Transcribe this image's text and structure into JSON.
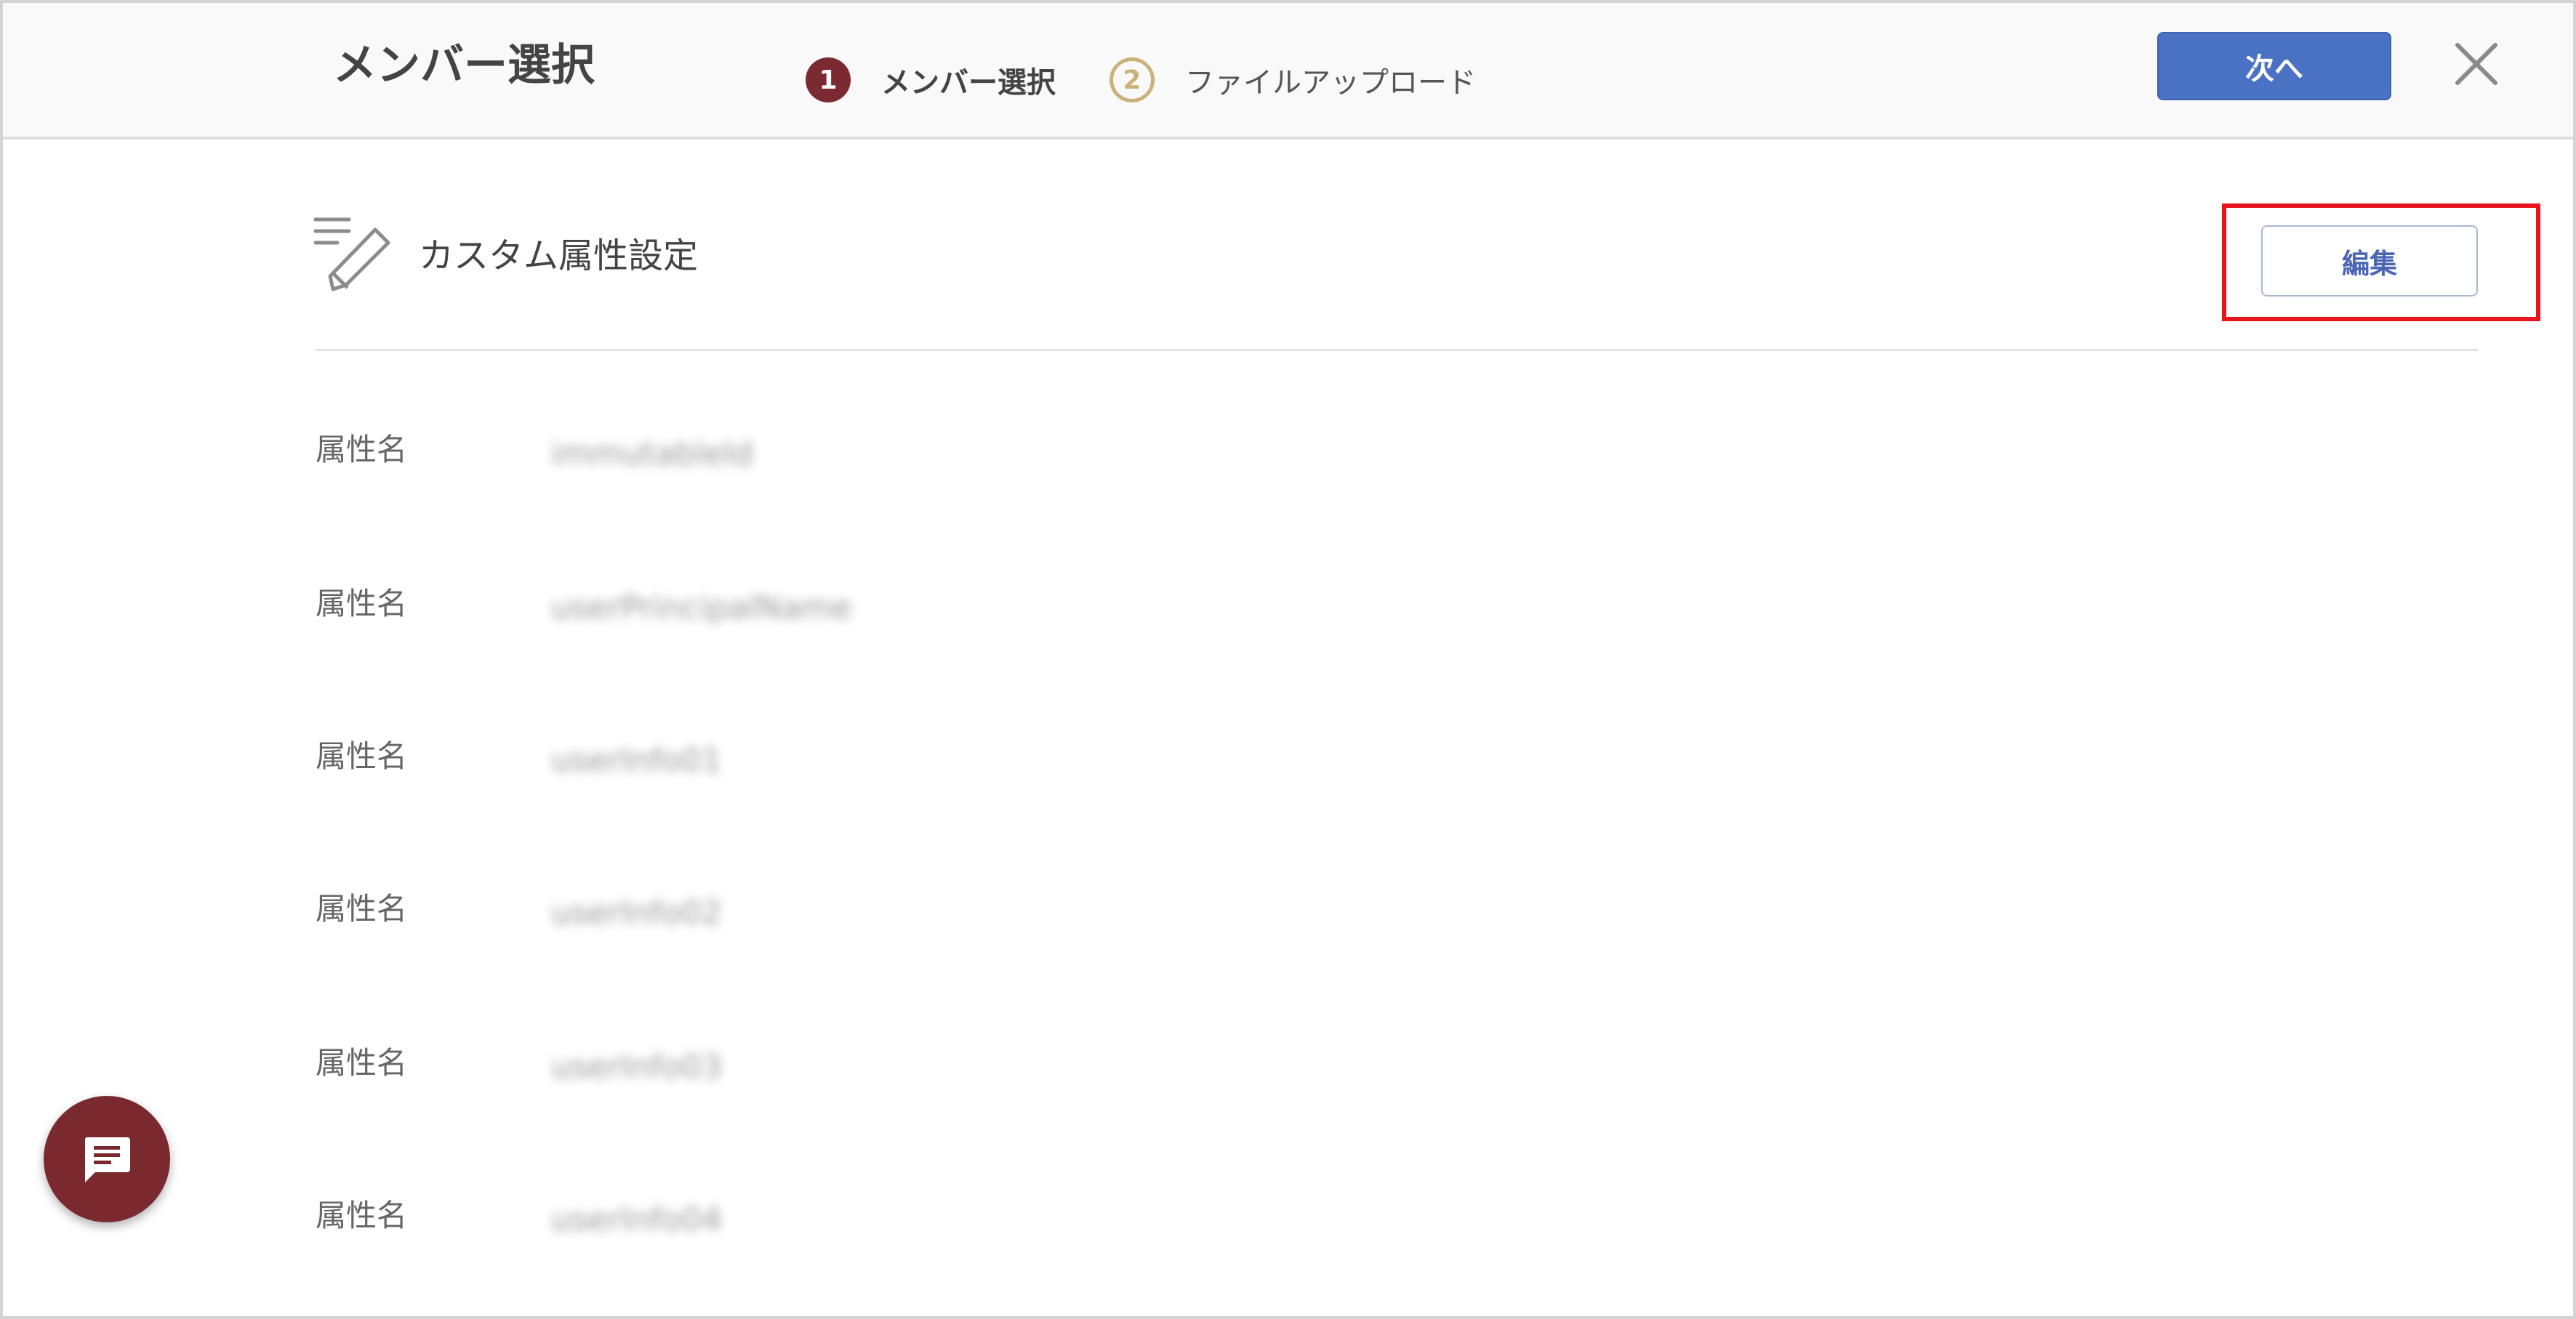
{
  "header": {
    "title": "メンバー選択",
    "steps": [
      {
        "number": "1",
        "label": "メンバー選択"
      },
      {
        "number": "2",
        "label": "ファイルアップロード"
      }
    ],
    "next_label": "次へ"
  },
  "section": {
    "title": "カスタム属性設定",
    "edit_label": "編集"
  },
  "attributes": [
    {
      "label": "属性名",
      "value": "immutableId"
    },
    {
      "label": "属性名",
      "value": "userPrincipalName"
    },
    {
      "label": "属性名",
      "value": "userInfo01"
    },
    {
      "label": "属性名",
      "value": "userInfo02"
    },
    {
      "label": "属性名",
      "value": "userInfo03"
    },
    {
      "label": "属性名",
      "value": "userInfo04"
    }
  ],
  "icons": {
    "close": "close-icon",
    "section": "edit-list-icon",
    "chat": "chat-icon"
  },
  "colors": {
    "primary": "#4a72c4",
    "step_active": "#7a2a30",
    "step_pending": "#c9b27a",
    "highlight": "#e8141c",
    "chat": "#7a2a2f"
  }
}
